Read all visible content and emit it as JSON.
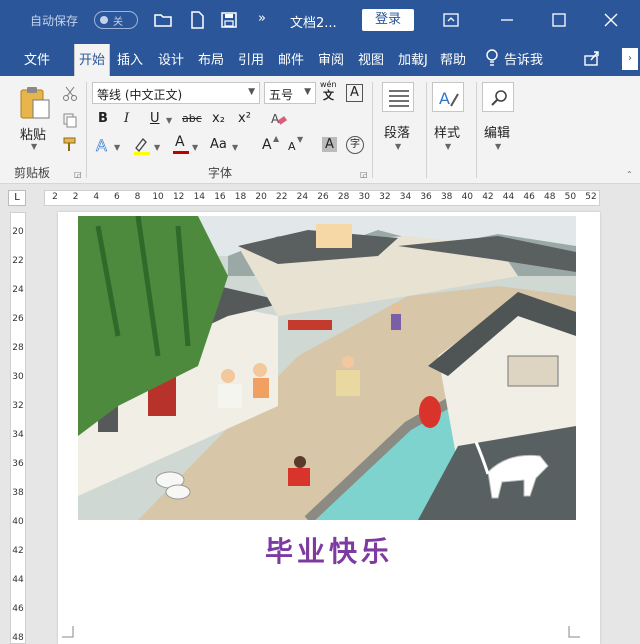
{
  "titlebar": {
    "autosave_label": "自动保存",
    "autosave_toggle_label": "关",
    "doc_title": "文档2...",
    "login_label": "登录",
    "more_glyph": "»"
  },
  "tabs": [
    {
      "label": "文件"
    },
    {
      "label": "开始"
    },
    {
      "label": "插入"
    },
    {
      "label": "设计"
    },
    {
      "label": "布局"
    },
    {
      "label": "引用"
    },
    {
      "label": "邮件"
    },
    {
      "label": "审阅"
    },
    {
      "label": "视图"
    },
    {
      "label": "加载J"
    },
    {
      "label": "帮助"
    },
    {
      "label": "告诉我"
    }
  ],
  "ribbon": {
    "paste_label": "粘贴",
    "clipboard_group": "剪贴板",
    "font_name": "等线 (中文正文)",
    "font_size": "五号",
    "font_group": "字体",
    "bold": "B",
    "italic": "I",
    "underline": "U",
    "strike": "abc",
    "subscript": "x₂",
    "superscript": "x²",
    "font_a": "A",
    "case_label": "Aa",
    "grow_font": "A",
    "shrink_font": "A",
    "char_shade": "A",
    "enclose_char": "字",
    "phonetic": "wén",
    "paragraph_label": "段落",
    "styles_label": "样式",
    "editing_label": "编辑"
  },
  "ruler": {
    "corner": "L",
    "h_ticks": [
      "2",
      "2",
      "4",
      "6",
      "8",
      "10",
      "12",
      "14",
      "16",
      "18",
      "20",
      "22",
      "24",
      "26",
      "28",
      "30",
      "32",
      "34",
      "36",
      "38",
      "40",
      "42",
      "44",
      "46",
      "48",
      "50",
      "52"
    ],
    "v_ticks": [
      "20",
      "22",
      "24",
      "26",
      "28",
      "30",
      "32",
      "34",
      "36",
      "38",
      "40",
      "42",
      "44",
      "46",
      "48"
    ]
  },
  "document": {
    "caption": "毕业快乐"
  },
  "colors": {
    "brand": "#2b579a",
    "caption": "#7d3aa0"
  }
}
